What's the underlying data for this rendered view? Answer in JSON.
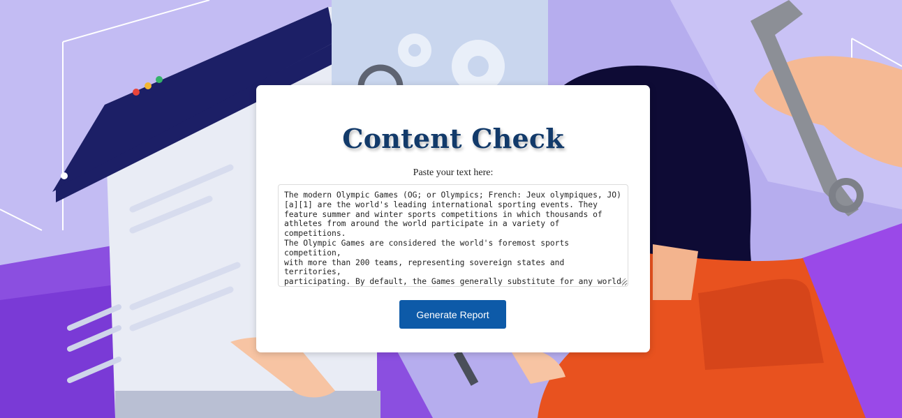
{
  "page": {
    "title": "Content Check",
    "input_label": "Paste your text here:",
    "text_value": "The modern Olympic Games (OG; or Olympics; French: Jeux olympiques, JO)\n[a][1] are the world's leading international sporting events. They\nfeature summer and winter sports competitions in which thousands of\nathletes from around the world participate in a variety of competitions.\nThe Olympic Games are considered the world's foremost sports competition,\nwith more than 200 teams, representing sovereign states and territories,\nparticipating. By default, the Games generally substitute for any world\nchampionships during the year in which they take place (however, each\nclass usually maintains its own records).[2] The Olympic Games are held\nevery four years. Since 1994, they have alternated between the Summer and",
    "button_label": "Generate Report"
  },
  "colors": {
    "title": "#123a6a",
    "button": "#0d5aa8",
    "background": "#b3a9ec"
  },
  "icons": [
    "gear-icon",
    "wrench-icon",
    "magnifier-icon",
    "hand-cursor-icon"
  ]
}
